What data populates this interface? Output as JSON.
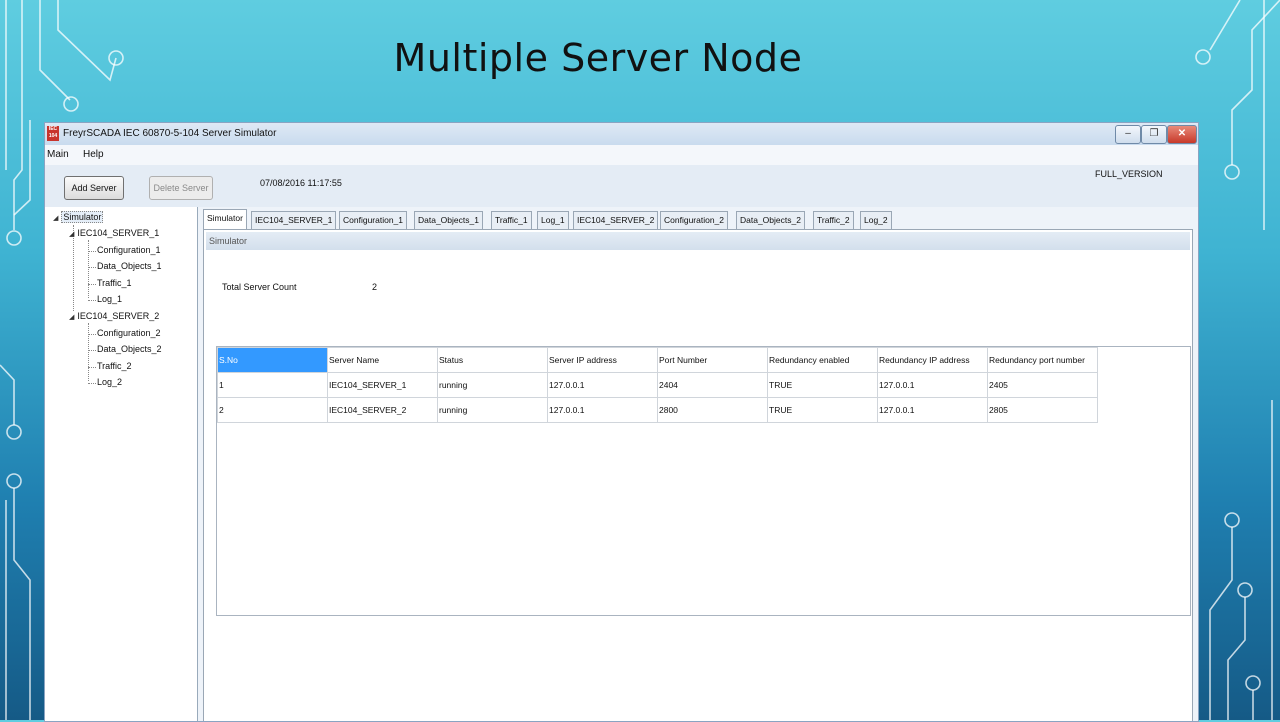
{
  "slide": {
    "title": "Multiple Server Node"
  },
  "window": {
    "app_icon_text": "IEC 104",
    "title": "FreyrSCADA IEC 60870-5-104 Server Simulator",
    "controls": {
      "minimize": "–",
      "maximize": "❐",
      "close": "✕"
    }
  },
  "menu": {
    "items": [
      "Main",
      "Help"
    ]
  },
  "toolbar": {
    "add_server": "Add Server",
    "delete_server": "Delete Server",
    "datetime": "07/08/2016 11:17:55",
    "version": "FULL_VERSION"
  },
  "tree": {
    "root": "Simulator",
    "servers": [
      {
        "name": "IEC104_SERVER_1",
        "children": [
          "Configuration_1",
          "Data_Objects_1",
          "Traffic_1",
          "Log_1"
        ]
      },
      {
        "name": "IEC104_SERVER_2",
        "children": [
          "Configuration_2",
          "Data_Objects_2",
          "Traffic_2",
          "Log_2"
        ]
      }
    ]
  },
  "tabs": [
    "Simulator",
    "IEC104_SERVER_1",
    "Configuration_1",
    "Data_Objects_1",
    "Traffic_1",
    "Log_1",
    "IEC104_SERVER_2",
    "Configuration_2",
    "Data_Objects_2",
    "Traffic_2",
    "Log_2"
  ],
  "panel": {
    "header": "Simulator",
    "total_server_count_label": "Total Server Count",
    "total_server_count_value": "2"
  },
  "grid": {
    "columns": [
      "S.No",
      "Server Name",
      "Status",
      "Server IP address",
      "Port Number",
      "Redundancy enabled",
      "Redundancy IP address",
      "Redundancy port number"
    ],
    "rows": [
      [
        "1",
        "IEC104_SERVER_1",
        "running",
        "127.0.0.1",
        "2404",
        "TRUE",
        "127.0.0.1",
        "2405"
      ],
      [
        "2",
        "IEC104_SERVER_2",
        "running",
        "127.0.0.1",
        "2800",
        "TRUE",
        "127.0.0.1",
        "2805"
      ]
    ]
  },
  "colors": {
    "selected_header": "#3399ff",
    "close_button": "#c7392a"
  }
}
